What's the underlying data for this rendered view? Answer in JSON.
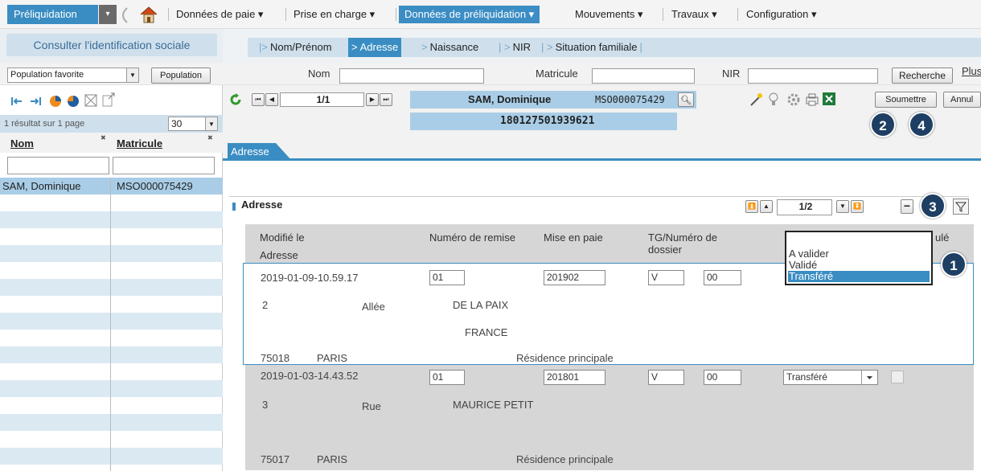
{
  "topnav": {
    "app_menu": "Préliquidation",
    "items": [
      "Données de paie",
      "Prise en charge",
      "Données de préliquidation",
      "Mouvements",
      "Travaux",
      "Configuration"
    ],
    "caret": "▾"
  },
  "left_title": "Consulter l'identification sociale",
  "tabs": [
    "Nom/Prénom",
    "Adresse",
    "Naissance",
    "NIR",
    "Situation familiale"
  ],
  "search": {
    "population_value": "Population favorite",
    "population_button": "Population",
    "nom_label": "Nom",
    "matricule_label": "Matricule",
    "nir_label": "NIR",
    "search_button": "Recherche",
    "plus_link": "Plus"
  },
  "results": {
    "summary": "1 résultat sur 1 page",
    "page_size": "30",
    "col_nom": "Nom",
    "col_matricule": "Matricule",
    "rows": [
      {
        "nom": "SAM, Dominique",
        "matricule": "MSO000075429"
      }
    ]
  },
  "record_nav": {
    "page": "1/1"
  },
  "person": {
    "name": "SAM, Dominique",
    "matricule": "MSO000075429",
    "nir": "180127501939621"
  },
  "toolbar": {
    "submit": "Soumettre",
    "cancel": "Annul"
  },
  "section_tab": "Adresse",
  "address_section": {
    "title": "Adresse",
    "page": "1/2"
  },
  "grid": {
    "headers": {
      "modified": "Modifié le",
      "address": "Adresse",
      "remise": "Numéro de remise",
      "mise": "Mise en paie",
      "tg": "TG/Numéro de dossier",
      "annule": "ulé"
    },
    "rows": [
      {
        "date": "2019-01-09-10.59.17",
        "remise": "01",
        "mise": "201902",
        "tg": "V",
        "dossier": "00",
        "status": "Transféré",
        "num": "2",
        "type": "Allée",
        "street": "DE LA PAIX",
        "country": "FRANCE",
        "postcode": "75018",
        "city": "PARIS",
        "residence": "Résidence principale"
      },
      {
        "date": "2019-01-03-14.43.52",
        "remise": "01",
        "mise": "201801",
        "tg": "V",
        "dossier": "00",
        "status": "Transféré",
        "num": "3",
        "type": "Rue",
        "street": "MAURICE PETIT",
        "country": "",
        "postcode": "75017",
        "city": "PARIS",
        "residence": "Résidence principale"
      }
    ]
  },
  "dropdown_options": [
    "A valider",
    "Validé",
    "Transféré"
  ],
  "badges": [
    "1",
    "2",
    "3",
    "4"
  ],
  "colors": {
    "accent": "#3a8dc2",
    "badge": "#1e3f63",
    "grid_bg": "#d6d6d6"
  }
}
